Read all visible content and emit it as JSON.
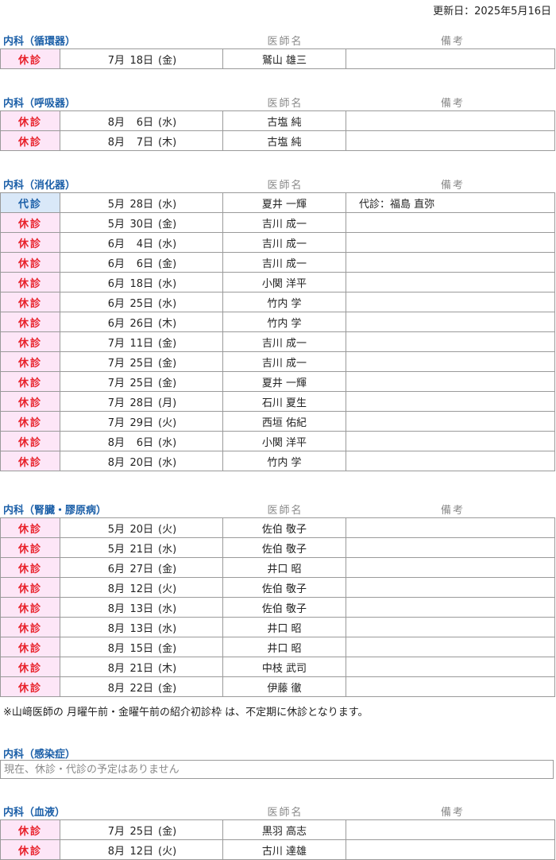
{
  "updated": "更新日：2025年5月16日",
  "headers": {
    "doctor": "医師名",
    "note": "備考"
  },
  "sections": [
    {
      "dept": "内科（循環器）",
      "rows": [
        {
          "status": "休診",
          "type": "kyu",
          "month": "7月",
          "day": "18日",
          "weekday": "(金)",
          "doctor": "鷲山 雄三",
          "note": ""
        }
      ]
    },
    {
      "dept": "内科（呼吸器）",
      "rows": [
        {
          "status": "休診",
          "type": "kyu",
          "month": "8月",
          "day": "6日",
          "weekday": "(水)",
          "doctor": "古塩 純",
          "note": ""
        },
        {
          "status": "休診",
          "type": "kyu",
          "month": "8月",
          "day": "7日",
          "weekday": "(木)",
          "doctor": "古塩 純",
          "note": ""
        }
      ]
    },
    {
      "dept": "内科（消化器）",
      "rows": [
        {
          "status": "代診",
          "type": "dai",
          "month": "5月",
          "day": "28日",
          "weekday": "(水)",
          "doctor": "夏井 一輝",
          "note": "代診：福島 直弥"
        },
        {
          "status": "休診",
          "type": "kyu",
          "month": "5月",
          "day": "30日",
          "weekday": "(金)",
          "doctor": "吉川 成一",
          "note": ""
        },
        {
          "status": "休診",
          "type": "kyu",
          "month": "6月",
          "day": "4日",
          "weekday": "(水)",
          "doctor": "吉川 成一",
          "note": ""
        },
        {
          "status": "休診",
          "type": "kyu",
          "month": "6月",
          "day": "6日",
          "weekday": "(金)",
          "doctor": "吉川 成一",
          "note": ""
        },
        {
          "status": "休診",
          "type": "kyu",
          "month": "6月",
          "day": "18日",
          "weekday": "(水)",
          "doctor": "小関 洋平",
          "note": ""
        },
        {
          "status": "休診",
          "type": "kyu",
          "month": "6月",
          "day": "25日",
          "weekday": "(水)",
          "doctor": "竹内 学",
          "note": ""
        },
        {
          "status": "休診",
          "type": "kyu",
          "month": "6月",
          "day": "26日",
          "weekday": "(木)",
          "doctor": "竹内 学",
          "note": ""
        },
        {
          "status": "休診",
          "type": "kyu",
          "month": "7月",
          "day": "11日",
          "weekday": "(金)",
          "doctor": "吉川 成一",
          "note": ""
        },
        {
          "status": "休診",
          "type": "kyu",
          "month": "7月",
          "day": "25日",
          "weekday": "(金)",
          "doctor": "吉川 成一",
          "note": ""
        },
        {
          "status": "休診",
          "type": "kyu",
          "month": "7月",
          "day": "25日",
          "weekday": "(金)",
          "doctor": "夏井 一輝",
          "note": ""
        },
        {
          "status": "休診",
          "type": "kyu",
          "month": "7月",
          "day": "28日",
          "weekday": "(月)",
          "doctor": "石川 夏生",
          "note": ""
        },
        {
          "status": "休診",
          "type": "kyu",
          "month": "7月",
          "day": "29日",
          "weekday": "(火)",
          "doctor": "西垣 佑紀",
          "note": ""
        },
        {
          "status": "休診",
          "type": "kyu",
          "month": "8月",
          "day": "6日",
          "weekday": "(水)",
          "doctor": "小関 洋平",
          "note": ""
        },
        {
          "status": "休診",
          "type": "kyu",
          "month": "8月",
          "day": "20日",
          "weekday": "(水)",
          "doctor": "竹内 学",
          "note": ""
        }
      ]
    },
    {
      "dept": "内科（腎臓・膠原病）",
      "rows": [
        {
          "status": "休診",
          "type": "kyu",
          "month": "5月",
          "day": "20日",
          "weekday": "(火)",
          "doctor": "佐伯 敬子",
          "note": ""
        },
        {
          "status": "休診",
          "type": "kyu",
          "month": "5月",
          "day": "21日",
          "weekday": "(水)",
          "doctor": "佐伯 敬子",
          "note": ""
        },
        {
          "status": "休診",
          "type": "kyu",
          "month": "6月",
          "day": "27日",
          "weekday": "(金)",
          "doctor": "井口 昭",
          "note": ""
        },
        {
          "status": "休診",
          "type": "kyu",
          "month": "8月",
          "day": "12日",
          "weekday": "(火)",
          "doctor": "佐伯 敬子",
          "note": ""
        },
        {
          "status": "休診",
          "type": "kyu",
          "month": "8月",
          "day": "13日",
          "weekday": "(水)",
          "doctor": "佐伯 敬子",
          "note": ""
        },
        {
          "status": "休診",
          "type": "kyu",
          "month": "8月",
          "day": "13日",
          "weekday": "(水)",
          "doctor": "井口 昭",
          "note": ""
        },
        {
          "status": "休診",
          "type": "kyu",
          "month": "8月",
          "day": "15日",
          "weekday": "(金)",
          "doctor": "井口 昭",
          "note": ""
        },
        {
          "status": "休診",
          "type": "kyu",
          "month": "8月",
          "day": "21日",
          "weekday": "(木)",
          "doctor": "中枝 武司",
          "note": ""
        },
        {
          "status": "休診",
          "type": "kyu",
          "month": "8月",
          "day": "22日",
          "weekday": "(金)",
          "doctor": "伊藤 徹",
          "note": ""
        }
      ]
    }
  ],
  "footnote": "※山﨑医師の 月曜午前・金曜午前の紹介初診枠 は、不定期に休診となります。",
  "infection": {
    "dept": "内科（感染症）",
    "message": "現在、休診・代診の予定はありません"
  },
  "blood": {
    "dept": "内科（血液）",
    "rows": [
      {
        "status": "休診",
        "type": "kyu",
        "month": "7月",
        "day": "25日",
        "weekday": "(金)",
        "doctor": "黒羽 高志",
        "note": ""
      },
      {
        "status": "休診",
        "type": "kyu",
        "month": "8月",
        "day": "12日",
        "weekday": "(火)",
        "doctor": "古川 達雄",
        "note": ""
      }
    ]
  }
}
